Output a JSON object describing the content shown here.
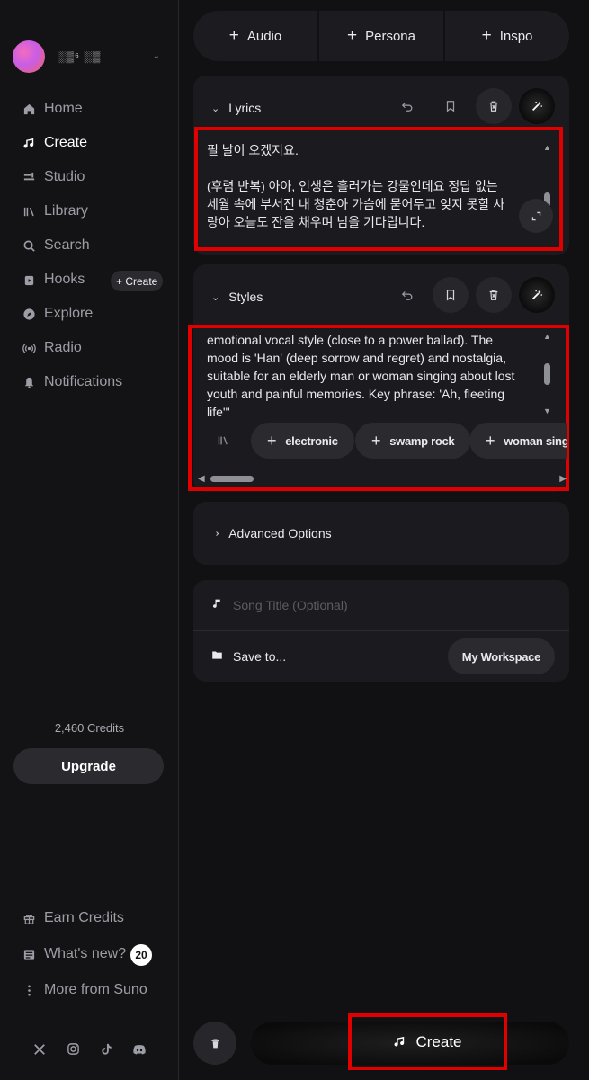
{
  "account": {
    "name": "░▒⁶ ░▒"
  },
  "nav": [
    {
      "id": "home",
      "label": "Home",
      "icon": "home-icon"
    },
    {
      "id": "create",
      "label": "Create",
      "icon": "music-note-icon",
      "active": true
    },
    {
      "id": "studio",
      "label": "Studio",
      "icon": "studio-icon"
    },
    {
      "id": "library",
      "label": "Library",
      "icon": "library-icon"
    },
    {
      "id": "search",
      "label": "Search",
      "icon": "search-icon"
    },
    {
      "id": "hooks",
      "label": "Hooks",
      "icon": "hooks-icon",
      "action": "+ Create"
    },
    {
      "id": "explore",
      "label": "Explore",
      "icon": "compass-icon"
    },
    {
      "id": "radio",
      "label": "Radio",
      "icon": "radio-icon"
    },
    {
      "id": "notifications",
      "label": "Notifications",
      "icon": "bell-icon"
    }
  ],
  "credits": {
    "text": "2,460 Credits"
  },
  "upgrade_label": "Upgrade",
  "bottom_nav": [
    {
      "id": "earn",
      "label": "Earn Credits",
      "icon": "gift-icon"
    },
    {
      "id": "whats_new",
      "label": "What's new?",
      "icon": "news-icon",
      "badge": "20"
    },
    {
      "id": "more",
      "label": "More from Suno",
      "icon": "more-vertical-icon"
    }
  ],
  "top_tabs": [
    {
      "id": "audio",
      "label": "Audio"
    },
    {
      "id": "persona",
      "label": "Persona"
    },
    {
      "id": "inspo",
      "label": "Inspo"
    }
  ],
  "lyrics": {
    "title": "Lyrics",
    "line1": "필 날이 오겠지요.",
    "line2": "(후렴 반복) 아아, 인생은 흘러가는 강물인데요 정답 없는",
    "line3": "세월 속에 부서진 내 청춘아 가슴에 묻어두고 잊지 못할 사",
    "line4": "랑아 오늘도 잔을 채우며 님을 기다립니다."
  },
  "styles": {
    "title": "Styles",
    "line1": "emotional vocal style (close to a power ballad). The",
    "line2": "mood is 'Han' (deep sorrow and regret) and nostalgia,",
    "line3": "suitable for an elderly man or woman singing about lost",
    "line4": "youth and painful memories. Key phrase: 'Ah, fleeting",
    "line5": "life'\"",
    "chips": [
      "electronic",
      "swamp rock",
      "woman singing"
    ]
  },
  "advanced_options": "Advanced Options",
  "song_title": {
    "placeholder": "Song Title (Optional)"
  },
  "save_to": {
    "label": "Save to...",
    "workspace": "My Workspace"
  },
  "create_button": "Create",
  "colors": {
    "accent_red": "#e00000",
    "background": "#111113",
    "card": "#1b1b1f"
  }
}
